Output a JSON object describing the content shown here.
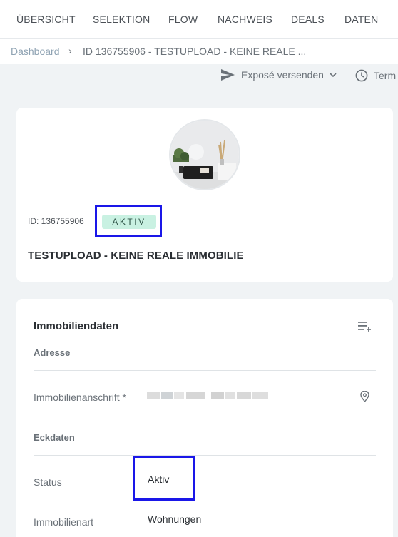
{
  "nav": {
    "tabs": [
      "ÜBERSICHT",
      "SELEKTION",
      "FLOW",
      "NACHWEIS",
      "DEALS",
      "DATEN"
    ]
  },
  "breadcrumb": {
    "home": "Dashboard",
    "separator": "›",
    "current": "ID 136755906 - TESTUPLOAD - KEINE REALE ..."
  },
  "actions": {
    "send_expose": "Exposé versenden",
    "termin": "Term"
  },
  "property": {
    "id_label": "ID: 136755906",
    "status_badge": "AKTIV",
    "title": "TESTUPLOAD - KEINE REALE IMMOBILIE"
  },
  "details": {
    "section_title": "Immobiliendaten",
    "address_heading": "Adresse",
    "address_label": "Immobilienanschrift",
    "required_marker": "*",
    "keydata_heading": "Eckdaten",
    "status_label": "Status",
    "status_value": "Aktiv",
    "type_label": "Immobilienart",
    "type_value": "Wohnungen"
  },
  "colors": {
    "badge_bg": "#c9f1e2",
    "highlight": "#1a17e8",
    "link": "#8fa3b3"
  }
}
